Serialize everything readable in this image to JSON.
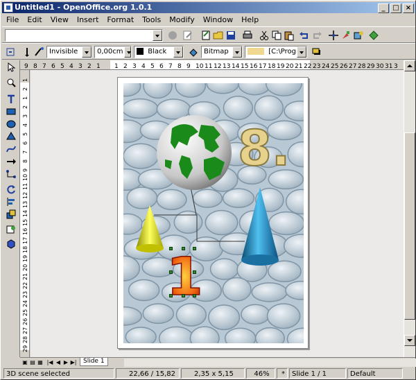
{
  "window": {
    "title": "Untitled1 - OpenOffice.org 1.0.1"
  },
  "window_controls": {
    "minimize": "_",
    "maximize": "□",
    "close": "×"
  },
  "menu": [
    "File",
    "Edit",
    "View",
    "Insert",
    "Format",
    "Tools",
    "Modify",
    "Window",
    "Help"
  ],
  "toolbar2": {
    "line_style": "Invisible",
    "line_width": "0,00cm",
    "line_color": "Black",
    "area_style": "Bitmap",
    "area_fill": "[C:\\Program"
  },
  "rulers": {
    "h_ticks": [
      "9",
      "8",
      "7",
      "6",
      "5",
      "4",
      "3",
      "2",
      "1",
      "",
      "1",
      "2",
      "3",
      "4",
      "5",
      "6",
      "7",
      "8",
      "9",
      "10",
      "11",
      "12",
      "13",
      "14",
      "15",
      "16",
      "17",
      "18",
      "19",
      "20",
      "21",
      "22",
      "23",
      "24",
      "25",
      "26",
      "27",
      "28",
      "29",
      "30",
      "31",
      "3"
    ],
    "v_ticks": [
      "1",
      "2",
      "1",
      "2",
      "3",
      "4",
      "5",
      "6",
      "7",
      "8",
      "9",
      "10",
      "11",
      "12",
      "13",
      "14",
      "15",
      "16",
      "17",
      "18",
      "19",
      "20",
      "21",
      "22",
      "23",
      "24",
      "25",
      "26",
      "27",
      "28",
      "29",
      "3"
    ]
  },
  "slide_tab": "Slide 1",
  "status": {
    "message": "3D scene selected",
    "position": "22,66 / 15,82",
    "size": "2,35 x 5,15",
    "zoom": "46%",
    "modified": "*",
    "slide": "Slide 1 / 1",
    "layout": "Default"
  },
  "colors": {
    "title_start": "#0a246a",
    "title_end": "#a6caf0",
    "canvas": "#ece9e9",
    "selection_handle": "#2e8b2e"
  }
}
